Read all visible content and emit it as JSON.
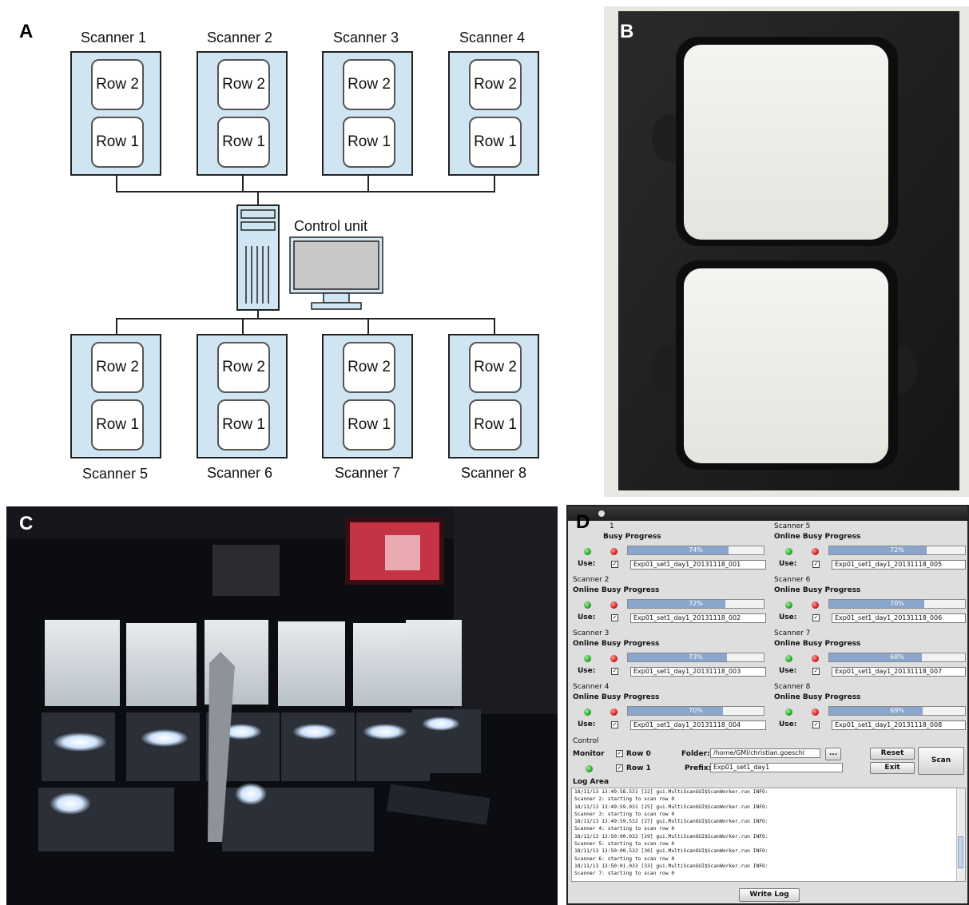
{
  "panel_labels": {
    "a": "A",
    "b": "B",
    "c": "C",
    "d": "D"
  },
  "diagram": {
    "top_scanners": [
      "Scanner 1",
      "Scanner 2",
      "Scanner 3",
      "Scanner 4"
    ],
    "bottom_scanners": [
      "Scanner 5",
      "Scanner 6",
      "Scanner 7",
      "Scanner 8"
    ],
    "row_top": "Row 2",
    "row_bottom": "Row 1",
    "control_unit": "Control unit",
    "colors": {
      "scanner_fill": "#cfe6f2",
      "unit_fill": "#cfe6f2",
      "screen": "#c8c8c8"
    }
  },
  "gui": {
    "scanners": [
      {
        "title": "1",
        "header": "Busy Progress",
        "progress": "74%",
        "progress_value": 0.74,
        "file": "Exp01_set1_day1_20131118_001"
      },
      {
        "title": "Scanner 2",
        "header": "Online  Busy Progress",
        "progress": "72%",
        "progress_value": 0.72,
        "file": "Exp01_set1_day1_20131118_002"
      },
      {
        "title": "Scanner 3",
        "header": "Online  Busy Progress",
        "progress": "73%",
        "progress_value": 0.73,
        "file": "Exp01_set1_day1_20131118_003"
      },
      {
        "title": "Scanner 4",
        "header": "Online  Busy Progress",
        "progress": "70%",
        "progress_value": 0.7,
        "file": "Exp01_set1_day1_20131118_004"
      },
      {
        "title": "Scanner 5",
        "header": "Online  Busy Progress",
        "progress": "72%",
        "progress_value": 0.72,
        "file": "Exp01_set1_day1_20131118_005"
      },
      {
        "title": "Scanner 6",
        "header": "Online  Busy Progress",
        "progress": "70%",
        "progress_value": 0.7,
        "file": "Exp01_set1_day1_20131118_006"
      },
      {
        "title": "Scanner 7",
        "header": "Online  Busy Progress",
        "progress": "68%",
        "progress_value": 0.68,
        "file": "Exp01_set1_day1_20131118_007"
      },
      {
        "title": "Scanner 8",
        "header": "Online  Busy Progress",
        "progress": "69%",
        "progress_value": 0.69,
        "file": "Exp01_set1_day1_20131118_008"
      }
    ],
    "use_label": "Use:",
    "control": {
      "title": "Control",
      "monitor_label": "Monitor",
      "row0_label": "Row 0",
      "row1_label": "Row 1",
      "folder_label": "Folder:",
      "folder_value": "/home/GMI/christian.goeschl",
      "prefix_label": "Prefix:",
      "prefix_value": "Exp01_set1_day1",
      "browse_label": "...",
      "reset_label": "Reset",
      "exit_label": "Exit",
      "scan_label": "Scan"
    },
    "log": {
      "title": "Log Area",
      "lines": [
        "18/11/13 13:49:58.531 [22] gui.MultiScanGUI$ScanWorker.run INFO:",
        "Scanner 2: starting to scan row 0",
        "18/11/13 13:49:59.031 [25] gui.MultiScanGUI$ScanWorker.run INFO:",
        "Scanner 3: starting to scan row 0",
        "18/11/13 13:49:59.532 [27] gui.MultiScanGUI$ScanWorker.run INFO:",
        "Scanner 4: starting to scan row 0",
        "18/11/13 13:50:00.032 [29] gui.MultiScanGUI$ScanWorker.run INFO:",
        "Scanner 5: starting to scan row 0",
        "18/11/13 13:50:00.532 [30] gui.MultiScanGUI$ScanWorker.run INFO:",
        "Scanner 6: starting to scan row 0",
        "18/11/13 13:50:01.033 [33] gui.MultiScanGUI$ScanWorker.run INFO:",
        "Scanner 7: starting to scan row 0"
      ],
      "write_log_label": "Write Log"
    }
  }
}
